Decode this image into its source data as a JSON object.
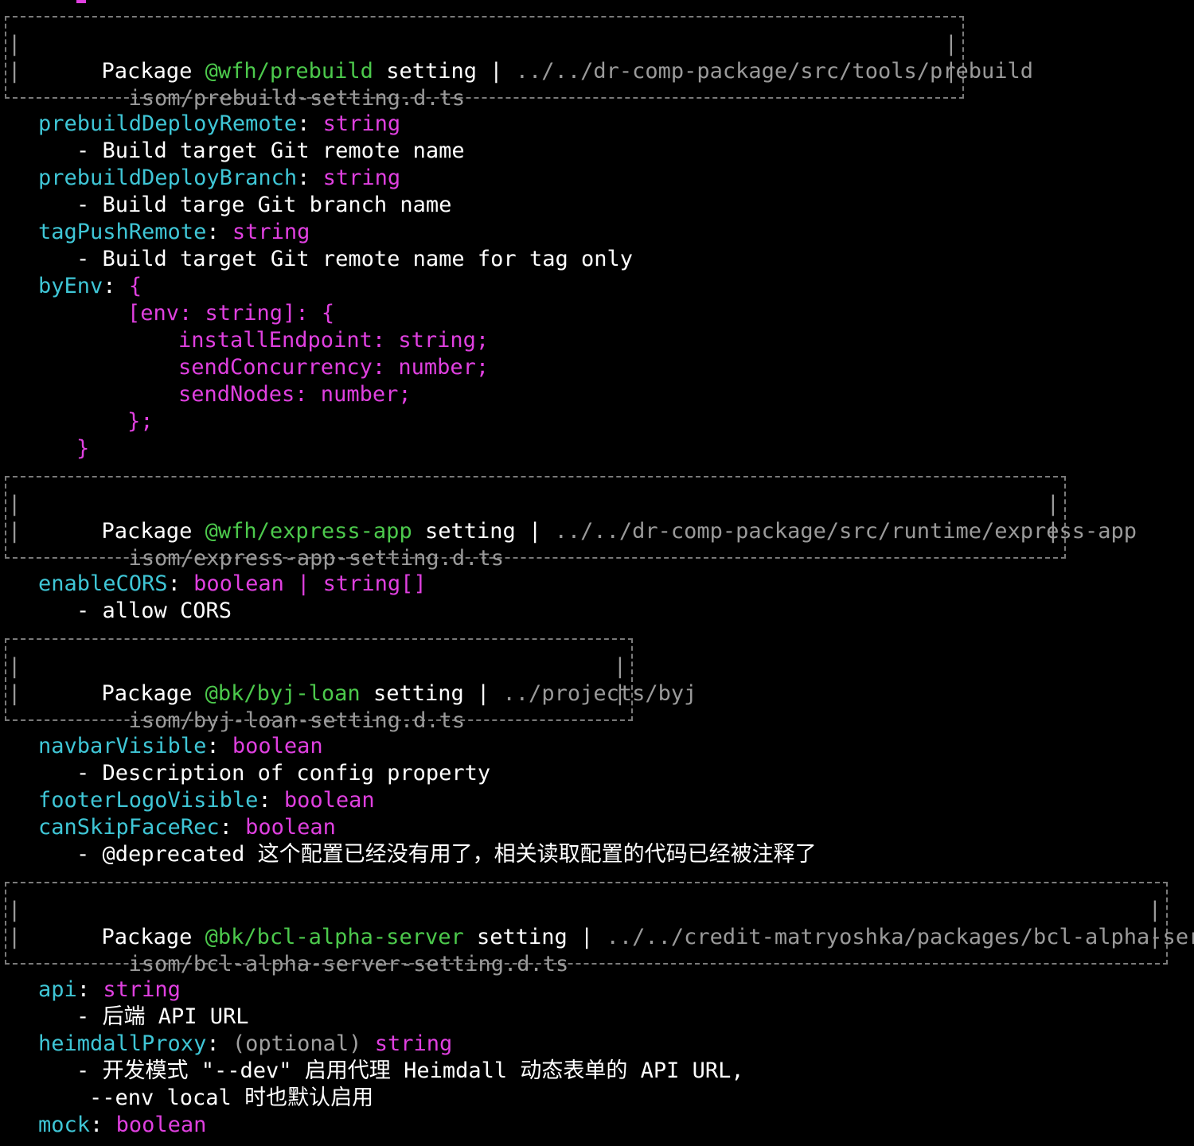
{
  "colors": {
    "background": "#000000",
    "package_name": "#4cc94c",
    "property_key": "#3fc6d6",
    "type": "#e040e0",
    "path": "#9a9a9a",
    "text": "#ffffff"
  },
  "sections": [
    {
      "header": {
        "word_package": "Package",
        "name": "@wfh/prebuild",
        "word_setting": "setting",
        "sep": "|",
        "path": "../../dr-comp-package/src/tools/prebuild",
        "file": "isom/prebuild-setting.d.ts"
      },
      "props": [
        {
          "key": "prebuildDeployRemote",
          "type": "string",
          "desc": "- Build target Git remote name"
        },
        {
          "key": "prebuildDeployBranch",
          "type": "string",
          "desc": "- Build targe Git branch name"
        },
        {
          "key": "tagPushRemote",
          "type": "string",
          "desc": "- Build target Git remote name for tag only"
        },
        {
          "key": "byEnv",
          "type": "{"
        }
      ],
      "byenv_body": [
        "[env: string]: {",
        "installEndpoint: string;",
        "sendConcurrency: number;",
        "sendNodes: number;",
        "};",
        "}"
      ]
    },
    {
      "header": {
        "word_package": "Package",
        "name": "@wfh/express-app",
        "word_setting": "setting",
        "sep": "|",
        "path": "../../dr-comp-package/src/runtime/express-app",
        "file": "isom/express-app-setting.d.ts"
      },
      "props": [
        {
          "key": "enableCORS",
          "type": "boolean | string[]",
          "desc": "- allow CORS"
        }
      ]
    },
    {
      "header": {
        "word_package": "Package",
        "name": "@bk/byj-loan",
        "word_setting": "setting",
        "sep": "|",
        "path": "../projects/byj",
        "file": "isom/byj-loan-setting.d.ts"
      },
      "props": [
        {
          "key": "navbarVisible",
          "type": "boolean",
          "desc": "- Description of config property"
        },
        {
          "key": "footerLogoVisible",
          "type": "boolean"
        },
        {
          "key": "canSkipFaceRec",
          "type": "boolean",
          "desc": "- @deprecated 这个配置已经没有用了，相关读取配置的代码已经被注释了"
        }
      ]
    },
    {
      "header": {
        "word_package": "Package",
        "name": "@bk/bcl-alpha-server",
        "word_setting": "setting",
        "sep": "|",
        "path": "../../credit-matryoshka/packages/bcl-alpha-server",
        "file": "isom/bcl-alpha-server-setting.d.ts"
      },
      "props": [
        {
          "key": "api",
          "type": "string",
          "desc": "- 后端 API URL"
        },
        {
          "key": "heimdallProxy",
          "optional": "(optional)",
          "type": "string",
          "desc": "- 开发模式 \"--dev\" 启用代理 Heimdall 动态表单的 API URL,",
          "desc2": "--env local 时也默认启用"
        },
        {
          "key": "mock",
          "type": "boolean"
        }
      ]
    }
  ],
  "colon": ":",
  "pipe": "|"
}
